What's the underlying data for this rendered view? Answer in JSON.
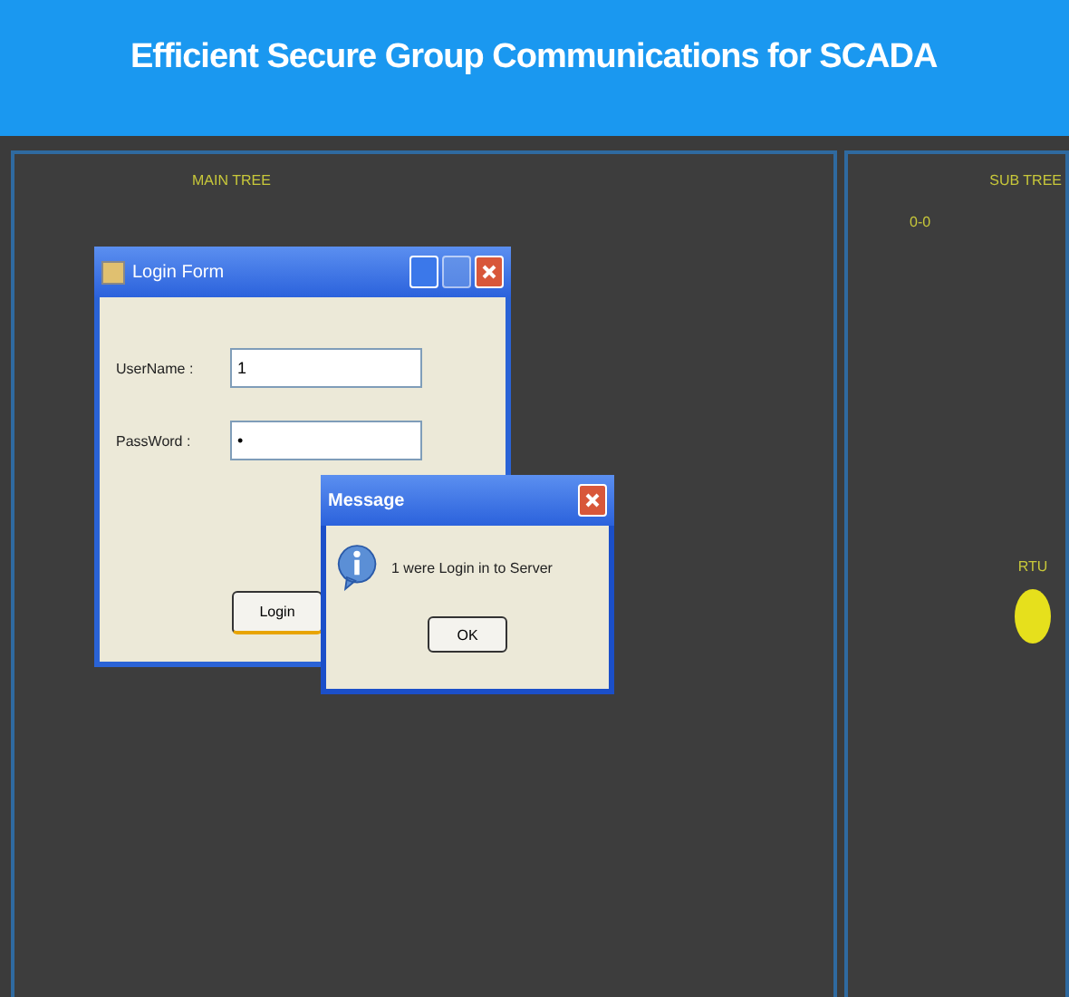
{
  "header": {
    "title": "Efficient Secure Group Communications for SCADA"
  },
  "main_panel": {
    "title": "MAIN TREE"
  },
  "sub_panel": {
    "title": "SUB TREE",
    "node_label": "0-0",
    "rtu": {
      "label": "RTU",
      "color": "#e6e01c"
    }
  },
  "login_window": {
    "title": "Login Form",
    "fields": [
      {
        "label": "UserName  :",
        "value": "1"
      },
      {
        "label": "PassWord :",
        "value": "•"
      }
    ],
    "button": "Login"
  },
  "message_dialog": {
    "title": "Message",
    "text": "1 were Login  in to Server",
    "button": "OK"
  }
}
